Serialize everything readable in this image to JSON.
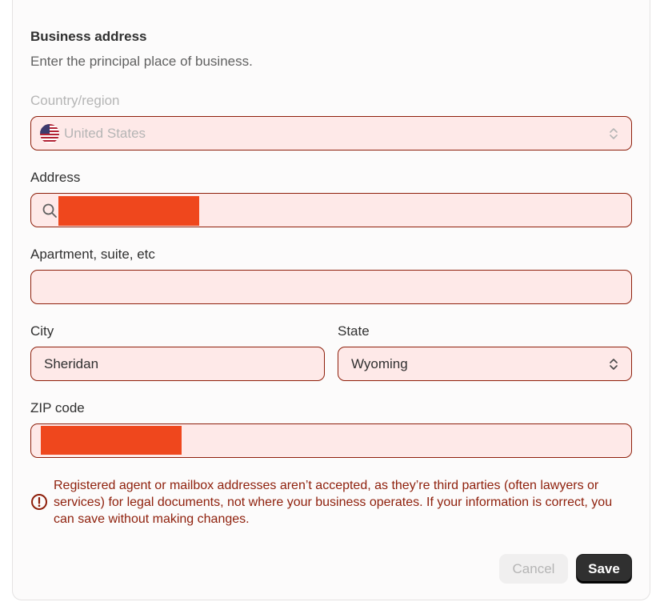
{
  "section": {
    "title": "Business address",
    "description": "Enter the principal place of business."
  },
  "country": {
    "label": "Country/region",
    "value": "United States",
    "flag_icon": "us-flag-icon",
    "disabled": true
  },
  "address": {
    "label": "Address",
    "value_redacted": true,
    "icon": "search-icon"
  },
  "apartment": {
    "label": "Apartment, suite, etc",
    "value": ""
  },
  "city": {
    "label": "City",
    "value": "Sheridan"
  },
  "state": {
    "label": "State",
    "value": "Wyoming"
  },
  "zip": {
    "label": "ZIP code",
    "value_redacted": true
  },
  "error": {
    "icon": "alert-circle-icon",
    "message": "Registered agent or mailbox addresses aren’t accepted, as they’re third parties (often lawyers or services) for legal documents, not where your business operates. If your information is correct, you can save without making changes."
  },
  "actions": {
    "cancel_label": "Cancel",
    "save_label": "Save"
  },
  "colors": {
    "error_text": "#8e1f0b",
    "field_bg": "#fee9e8",
    "redaction": "#ef471d",
    "save_bg": "#303030"
  }
}
